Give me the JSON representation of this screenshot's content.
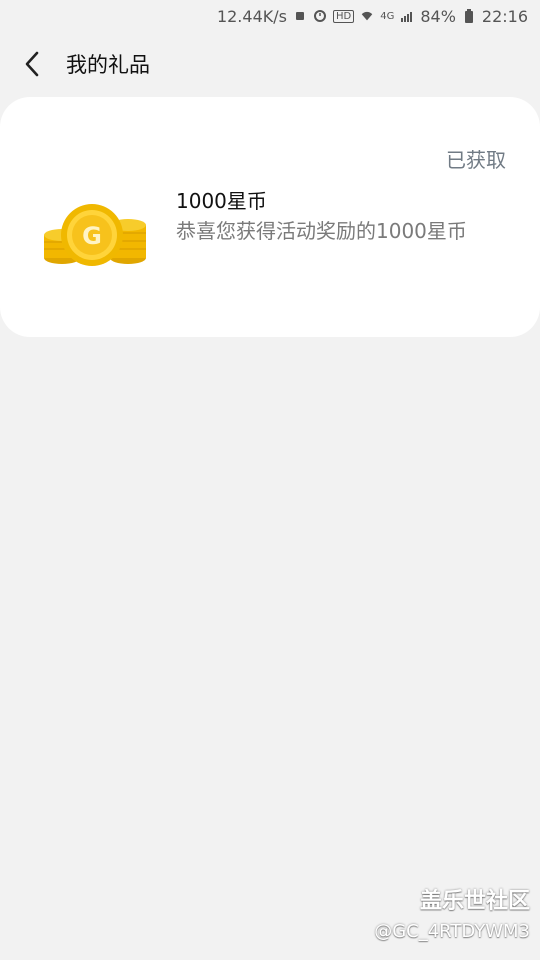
{
  "status_bar": {
    "speed": "12.44K/s",
    "battery": "84%",
    "time": "22:16",
    "signal": "4G",
    "hd": "HD"
  },
  "header": {
    "title": "我的礼品"
  },
  "gift": {
    "status": "已获取",
    "title": "1000星币",
    "description": "恭喜您获得活动奖励的1000星币",
    "coin_letter": "G"
  },
  "watermark": {
    "brand": "盖乐世社区",
    "user": "@GC_4RTDYWM3"
  },
  "colors": {
    "background": "#f2f2f2",
    "card": "#ffffff",
    "status_text": "#717b85",
    "coin_gold": "#f5c400"
  }
}
